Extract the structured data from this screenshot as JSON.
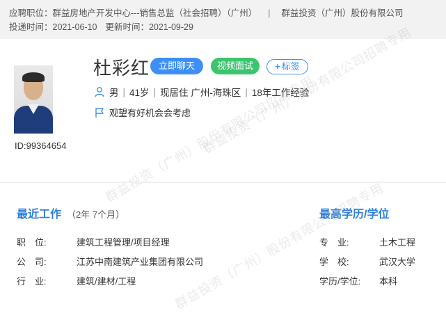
{
  "header": {
    "position_label": "应聘职位：",
    "position_value": "群益房地产开发中心---销售总监（社会招聘）（广州）",
    "separator": "|",
    "company": "群益投资（广州）股份有限公司",
    "submit_label": "投递时间：",
    "submit_date": "2021-06-10",
    "update_label": "更新时间：",
    "update_date": "2021-09-29"
  },
  "candidate": {
    "name": "杜彩红",
    "id_text": "ID:99364654",
    "gender": "男",
    "age": "41岁",
    "residence": "现居住 广州-海珠区",
    "experience": "18年工作经验",
    "status": "观望有好机会会考虑",
    "divider": "|"
  },
  "actions": {
    "chat_label": "立即聊天",
    "video_label": "视频面试",
    "tag_plus": "+",
    "tag_label": "标签"
  },
  "watermark": "群益投资（广州）股份有限公司招聘专用",
  "recent_work": {
    "title": "最近工作",
    "duration": "（2年 7个月）",
    "rows": [
      {
        "label": "职　位:",
        "value": "建筑工程管理/项目经理"
      },
      {
        "label": "公　司:",
        "value": "江苏中南建筑产业集团有限公司"
      },
      {
        "label": "行　业:",
        "value": "建筑/建材/工程"
      }
    ]
  },
  "education": {
    "title": "最高学历/学位",
    "rows": [
      {
        "label": "专　业:",
        "value": "土木工程"
      },
      {
        "label": "学　校:",
        "value": "武汉大学"
      },
      {
        "label": "学历/学位:",
        "value": "本科"
      }
    ]
  },
  "colors": {
    "accent_blue": "#3d8ff5",
    "accent_green": "#3cc46e",
    "section_title": "#2f7fd6"
  }
}
